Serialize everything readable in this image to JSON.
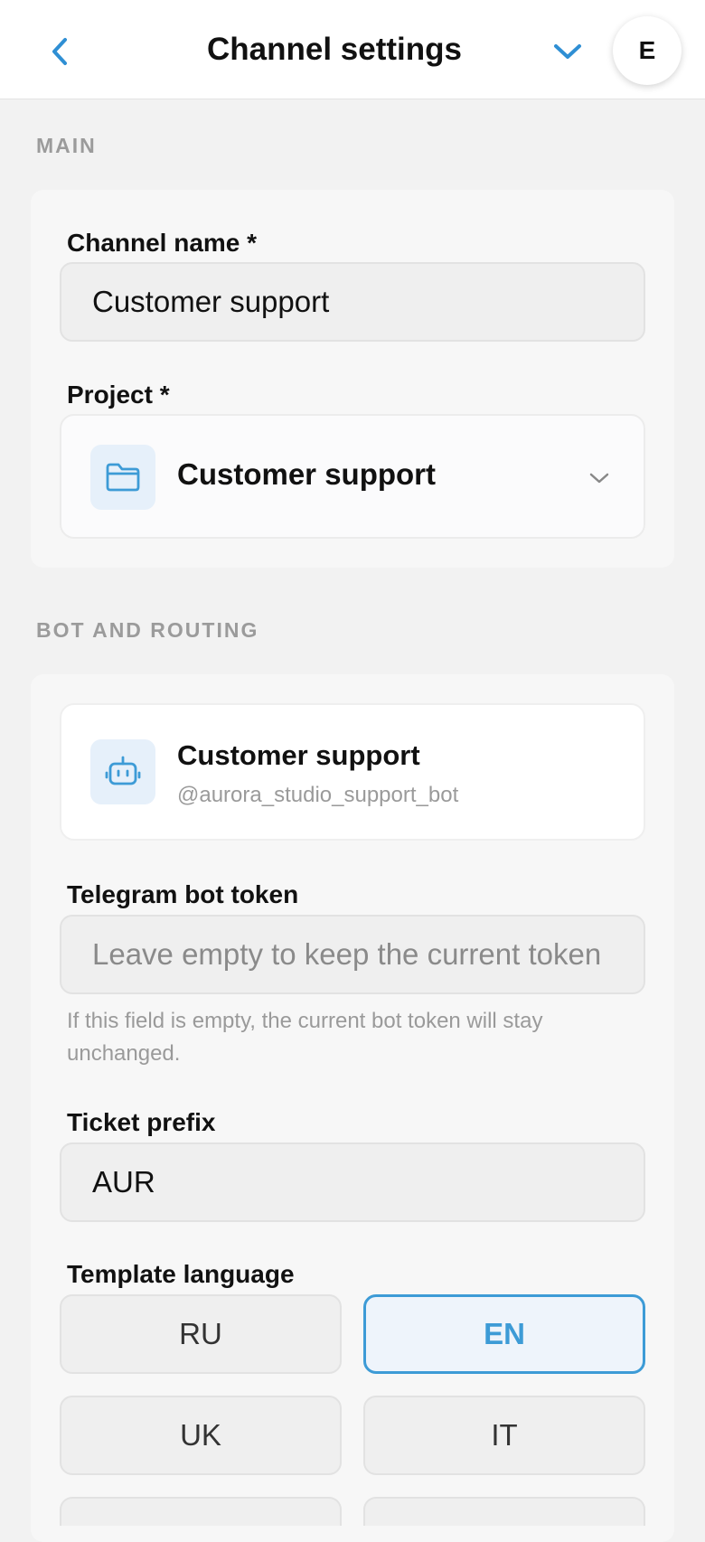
{
  "header": {
    "title": "Channel settings",
    "avatar_initial": "E",
    "back_icon": "chevron-left-icon",
    "menu_icon": "chevron-down-icon",
    "accent_color": "#2f8fd4"
  },
  "main": {
    "section_title": "MAIN",
    "channel_name": {
      "label": "Channel name *",
      "value": "Customer support"
    },
    "project": {
      "label": "Project *",
      "selected": "Customer support",
      "icon": "folder-icon"
    }
  },
  "bot_routing": {
    "section_title": "BOT AND ROUTING",
    "bot": {
      "name": "Customer support",
      "handle": "@aurora_studio_support_bot",
      "icon": "bot-icon"
    },
    "token": {
      "label": "Telegram bot token",
      "placeholder": "Leave empty to keep the current token",
      "hint": "If this field is empty, the current bot token will stay unchanged."
    },
    "ticket_prefix": {
      "label": "Ticket prefix",
      "value": "AUR"
    },
    "template_language": {
      "label": "Template language",
      "options": [
        "RU",
        "EN",
        "UK",
        "IT"
      ],
      "selected": "EN"
    }
  }
}
